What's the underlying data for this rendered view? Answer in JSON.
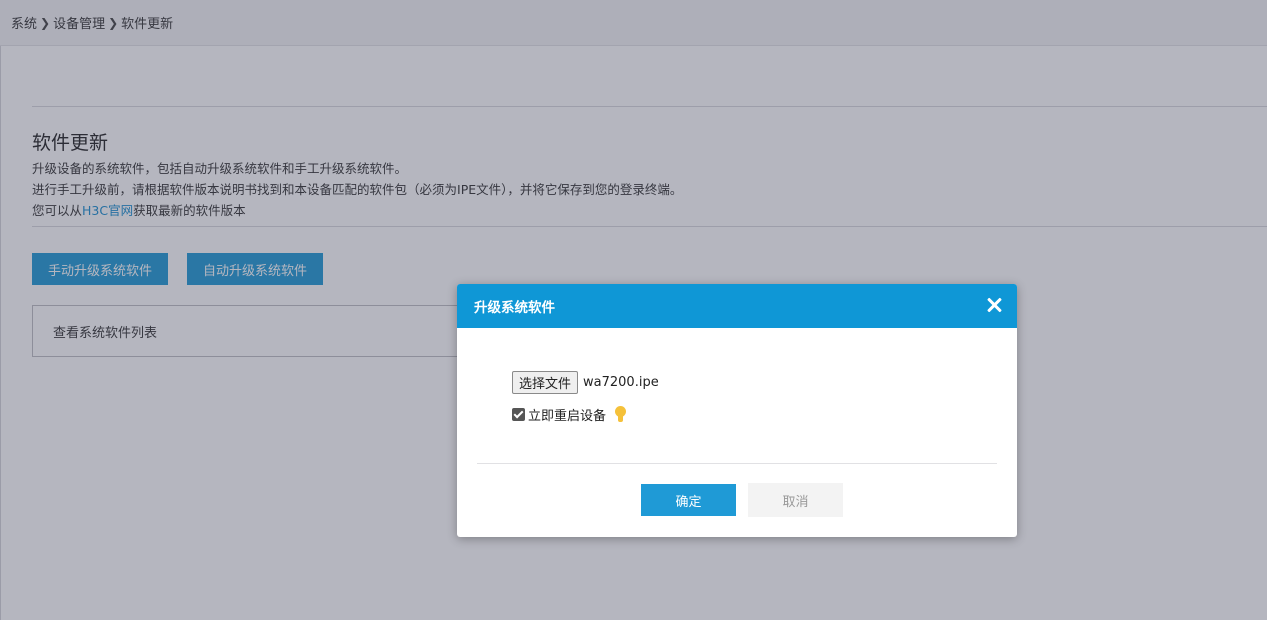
{
  "breadcrumb": {
    "items": [
      "系统",
      "设备管理",
      "软件更新"
    ],
    "separator": "❯"
  },
  "main": {
    "title": "软件更新",
    "desc_line1": "升级设备的系统软件，包括自动升级系统软件和手工升级系统软件。",
    "desc_line2": "进行手工升级前，请根据软件版本说明书找到和本设备匹配的软件包（必须为IPE文件），并将它保存到您的登录终端。",
    "desc_line3_prefix": "您可以从",
    "desc_line3_link": "H3C官网",
    "desc_line3_suffix": "获取最新的软件版本",
    "manual_button": "手动升级系统软件",
    "auto_button": "自动升级系统软件",
    "list_box_label": "查看系统软件列表"
  },
  "modal": {
    "title": "升级系统软件",
    "file_button": "选择文件",
    "file_name": "wa7200.ipe",
    "restart_label": "立即重启设备",
    "restart_checked": true,
    "ok_button": "确定",
    "cancel_button": "取消"
  },
  "colors": {
    "accent": "#1f9ad6",
    "modal_header": "#0f97d6",
    "link": "#1a8fd1",
    "bulb": "#f5c13a"
  },
  "icons": {
    "breadcrumb_separator": "chevron-right-icon",
    "close": "close-icon",
    "tip": "lightbulb-icon"
  }
}
